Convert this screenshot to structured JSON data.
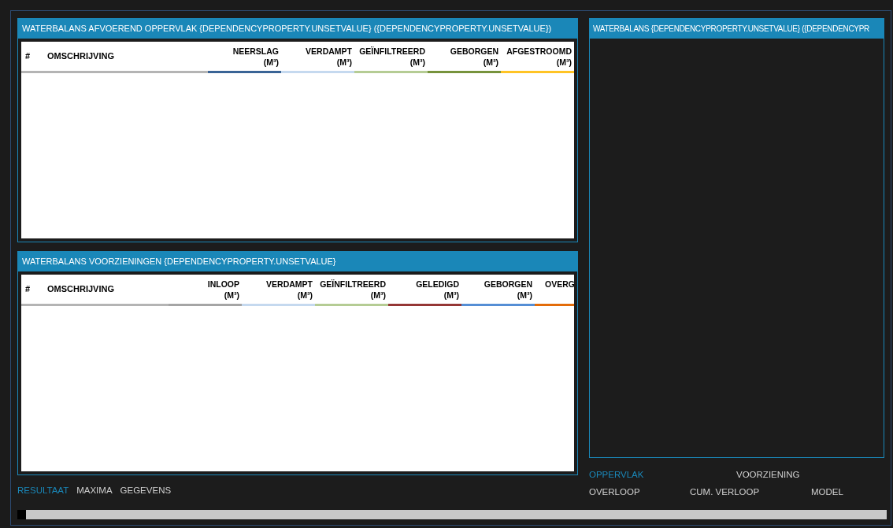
{
  "tables": [
    {
      "title": "WATERBALANS AFVOEREND OPPERVLAK {DEPENDENCYPROPERTY.UNSETVALUE} ({DEPENDENCYPROPERTY.UNSETVALUE})",
      "index_header": "#",
      "description_header": "OMSCHRIJVING",
      "columns": [
        {
          "label": "NEERSLAG",
          "unit": "(M³)",
          "color": "#3a6496"
        },
        {
          "label": "VERDAMPT",
          "unit": "(M³)",
          "color": "#c5d9ef"
        },
        {
          "label": "GEÏNFILTREERD",
          "unit": "(M³)",
          "color": "#b5cc94"
        },
        {
          "label": "GEBORGEN",
          "unit": "(M³)",
          "color": "#77933c"
        },
        {
          "label": "AFGESTROOMD",
          "unit": "(M³)",
          "color": "#ffc425"
        }
      ]
    },
    {
      "title": "WATERBALANS VOORZIENINGEN {DEPENDENCYPROPERTY.UNSETVALUE}",
      "index_header": "#",
      "description_header": "OMSCHRIJVING",
      "columns": [
        {
          "label": "INLOOP",
          "unit": "(M³)",
          "color": "#a5a5a5"
        },
        {
          "label": "VERDAMPT",
          "unit": "(M³)",
          "color": "#c5d9ef"
        },
        {
          "label": "GEÏNFILTREERD",
          "unit": "(M³)",
          "color": "#b5cc94"
        },
        {
          "label": "GELEDIGD",
          "unit": "(M³)",
          "color": "#953735"
        },
        {
          "label": "GEBORGEN",
          "unit": "(M³)",
          "color": "#558ed5"
        },
        {
          "label": "OVERG",
          "color": "#e36c09"
        }
      ]
    }
  ],
  "result_tabs": [
    {
      "label": "RESULTAAT",
      "selected": true
    },
    {
      "label": "MAXIMA",
      "selected": false
    },
    {
      "label": "GEGEVENS",
      "selected": false
    }
  ],
  "chart_panel": {
    "title": "WATERBALANS {DEPENDENCYPROPERTY.UNSETVALUE} ({DEPENDENCYPR"
  },
  "chart_tabs": [
    [
      {
        "label": "OPPERVLAK",
        "selected": true
      },
      {
        "label": "VOORZIENING",
        "selected": false
      }
    ],
    [
      {
        "label": "OVERLOOP",
        "selected": false
      },
      {
        "label": "CUM. VERLOOP",
        "selected": false
      },
      {
        "label": "MODEL",
        "selected": false
      }
    ]
  ]
}
